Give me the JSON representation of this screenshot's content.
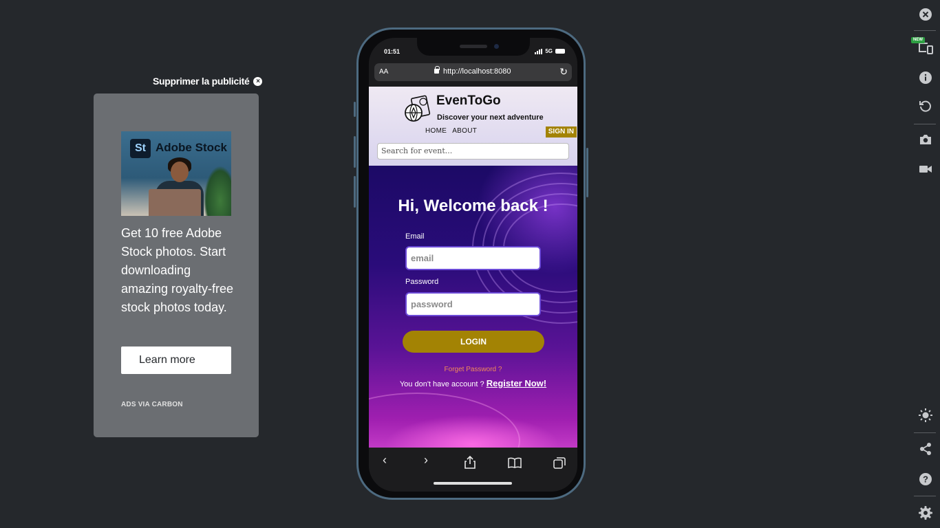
{
  "ad": {
    "remove_label": "Supprimer la publicité",
    "logo_mark": "St",
    "logo_text": "Adobe Stock",
    "body": "Get 10 free Adobe Stock photos. Start downloading amazing royalty-free stock photos today.",
    "cta": "Learn more",
    "via": "ADS VIA CARBON"
  },
  "phone": {
    "status": {
      "time": "01:51",
      "network": "5G"
    },
    "browser": {
      "aa_label": "AA",
      "url": "http://localhost:8080"
    },
    "site": {
      "brand": "EvenToGo",
      "tagline": "Discover your next adventure",
      "nav": [
        "HOME",
        "ABOUT"
      ],
      "signin": "SIGN IN",
      "search_placeholder": "Search for event..."
    },
    "login_form": {
      "heading": "Hi, Welcome back !",
      "email_label": "Email",
      "email_placeholder": "email",
      "password_label": "Password",
      "password_placeholder": "password",
      "submit": "LOGIN",
      "forgot": "Forget Password ?",
      "no_account": "You don't have account ?",
      "register": "Register Now!"
    }
  },
  "rail": {
    "new_badge": "NEW",
    "icons": [
      "close-icon",
      "devices-icon",
      "info-icon",
      "rotate-icon",
      "camera-icon",
      "video-icon",
      "brightness-icon",
      "share-icon",
      "help-icon",
      "settings-icon"
    ]
  }
}
